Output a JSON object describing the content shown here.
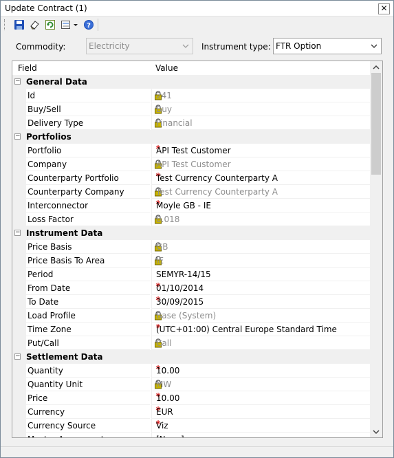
{
  "window": {
    "title": "Update Contract (1)",
    "close_label": "✕"
  },
  "toolbar": {
    "items": [
      {
        "name": "save-icon"
      },
      {
        "name": "eraser-icon"
      },
      {
        "name": "refresh-icon"
      },
      {
        "name": "report-dropdown-icon"
      },
      {
        "name": "help-icon"
      }
    ]
  },
  "filters": {
    "commodity_label": "Commodity:",
    "commodity_value": "Electricity",
    "instrument_label": "Instrument type:",
    "instrument_value": "FTR Option"
  },
  "grid": {
    "header_field": "Field",
    "header_value": "Value",
    "rows": [
      {
        "type": "category",
        "label": "General Data"
      },
      {
        "type": "prop",
        "field": "Id",
        "marker": "lock",
        "value": "241"
      },
      {
        "type": "prop",
        "field": "Buy/Sell",
        "marker": "lock",
        "value": "Buy"
      },
      {
        "type": "prop",
        "field": "Delivery Type",
        "marker": "lock",
        "value": "Financial"
      },
      {
        "type": "category",
        "label": "Portfolios"
      },
      {
        "type": "prop",
        "field": "Portfolio",
        "marker": "required",
        "value": "API Test Customer"
      },
      {
        "type": "prop",
        "field": "Company",
        "marker": "lock",
        "value": "API Test Customer"
      },
      {
        "type": "prop",
        "field": "Counterparty Portfolio",
        "marker": "required",
        "value": "Test Currency Counterparty A"
      },
      {
        "type": "prop",
        "field": "Counterparty Company",
        "marker": "lock",
        "value": "Test Currency Counterparty A"
      },
      {
        "type": "prop",
        "field": "Interconnector",
        "marker": "required",
        "value": "Moyle GB - IE"
      },
      {
        "type": "prop",
        "field": "Loss Factor",
        "marker": "lock",
        "value": "0.018"
      },
      {
        "type": "category",
        "label": "Instrument Data"
      },
      {
        "type": "prop",
        "field": "Price Basis",
        "marker": "lock",
        "value": "GB"
      },
      {
        "type": "prop",
        "field": "Price Basis To Area",
        "marker": "lock",
        "value": "IE"
      },
      {
        "type": "prop",
        "field": "Period",
        "marker": "",
        "value": "SEMYR-14/15"
      },
      {
        "type": "prop",
        "field": "From Date",
        "marker": "required",
        "value": "01/10/2014"
      },
      {
        "type": "prop",
        "field": "To Date",
        "marker": "required",
        "value": "30/09/2015"
      },
      {
        "type": "prop",
        "field": "Load Profile",
        "marker": "lock",
        "value": "Base (System)"
      },
      {
        "type": "prop",
        "field": "Time Zone",
        "marker": "required",
        "value": "(UTC+01:00) Central Europe Standard Time"
      },
      {
        "type": "prop",
        "field": "Put/Call",
        "marker": "lock",
        "value": "Call"
      },
      {
        "type": "category",
        "label": "Settlement Data"
      },
      {
        "type": "prop",
        "field": "Quantity",
        "marker": "required",
        "value": "10.00"
      },
      {
        "type": "prop",
        "field": "Quantity Unit",
        "marker": "lock",
        "value": "MW"
      },
      {
        "type": "prop",
        "field": "Price",
        "marker": "required",
        "value": "10.00"
      },
      {
        "type": "prop",
        "field": "Currency",
        "marker": "required",
        "value": "EUR"
      },
      {
        "type": "prop",
        "field": "Currency Source",
        "marker": "required",
        "value": "Viz"
      },
      {
        "type": "prop",
        "field": "Master Agreement",
        "marker": "",
        "value": "[None]"
      }
    ]
  },
  "colors": {
    "required": "#d61818",
    "locked_text": "#8d8d8d",
    "lock_icon": "#c8b400"
  }
}
